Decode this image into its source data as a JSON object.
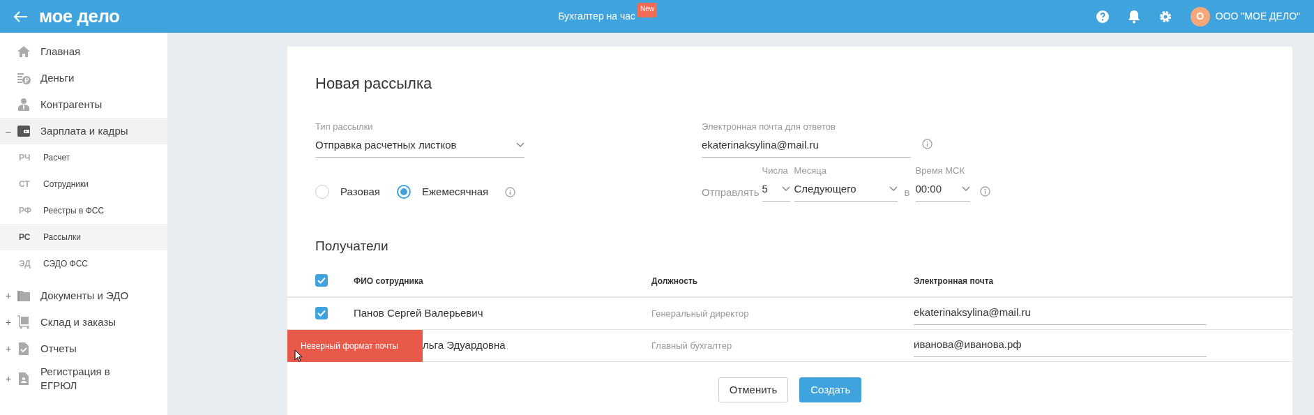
{
  "topbar": {
    "logo": "мое дело",
    "center": "Бухгалтер на час",
    "center_badge": "New",
    "avatar": "О",
    "org": "ООО \"МОЕ ДЕЛО\""
  },
  "sidebar": {
    "items": [
      {
        "label": "Главная",
        "selected": false
      },
      {
        "label": "Деньги",
        "selected": false
      },
      {
        "label": "Контрагенты",
        "selected": false
      },
      {
        "label": "Зарплата и кадры",
        "expander": "–",
        "selected": true,
        "children": [
          {
            "abbr": "РЧ",
            "label": "Расчет",
            "selected": false
          },
          {
            "abbr": "СТ",
            "label": "Сотрудники",
            "selected": false
          },
          {
            "abbr": "РФ",
            "label": "Реестры в ФСС",
            "selected": false
          },
          {
            "abbr": "РС",
            "label": "Рассылки",
            "selected": true
          },
          {
            "abbr": "ЭД",
            "label": "СЭДО ФСС",
            "selected": false
          }
        ]
      },
      {
        "label": "Документы и ЭДО",
        "expander": "+",
        "selected": false
      },
      {
        "label": "Склад и заказы",
        "expander": "+",
        "selected": false
      },
      {
        "label": "Отчеты",
        "expander": "+",
        "selected": false
      },
      {
        "label": "Регистрация в ЕГРЮЛ",
        "expander": "+",
        "selected": false
      }
    ]
  },
  "form": {
    "title": "Новая рассылка",
    "type_field": {
      "label": "Тип рассылки",
      "value": "Отправка расчетных листков"
    },
    "reply_field": {
      "label": "Электронная почта для ответов",
      "value": "ekaterinaksylina@mail.ru"
    },
    "frequency": [
      {
        "label": "Разовая",
        "selected": false
      },
      {
        "label": "Ежемесячная",
        "selected": true
      }
    ],
    "schedule": {
      "send_label": "Отправлять",
      "day": {
        "label": "Числа",
        "value": "5"
      },
      "month": {
        "label": "Месяца",
        "value": "Следующего"
      },
      "at": "в",
      "time": {
        "label": "Время МСК",
        "value": "00:00"
      }
    }
  },
  "recipients": {
    "title": "Получатели",
    "all_checked": true,
    "columns": [
      "ФИО сотрудника",
      "Должность",
      "Электронная почта"
    ],
    "rows": [
      {
        "checked": true,
        "name": "Панов Сергей Валерьевич",
        "position": "Генеральный директор",
        "email": "ekaterinaksylina@mail.ru"
      },
      {
        "name": "льга Эдуардовна",
        "position": "Главный бухгалтер",
        "email": "иванова@иванова.рф",
        "error": "Неверный формат почты"
      }
    ]
  },
  "buttons": {
    "cancel": "Отменить",
    "create": "Создать"
  }
}
